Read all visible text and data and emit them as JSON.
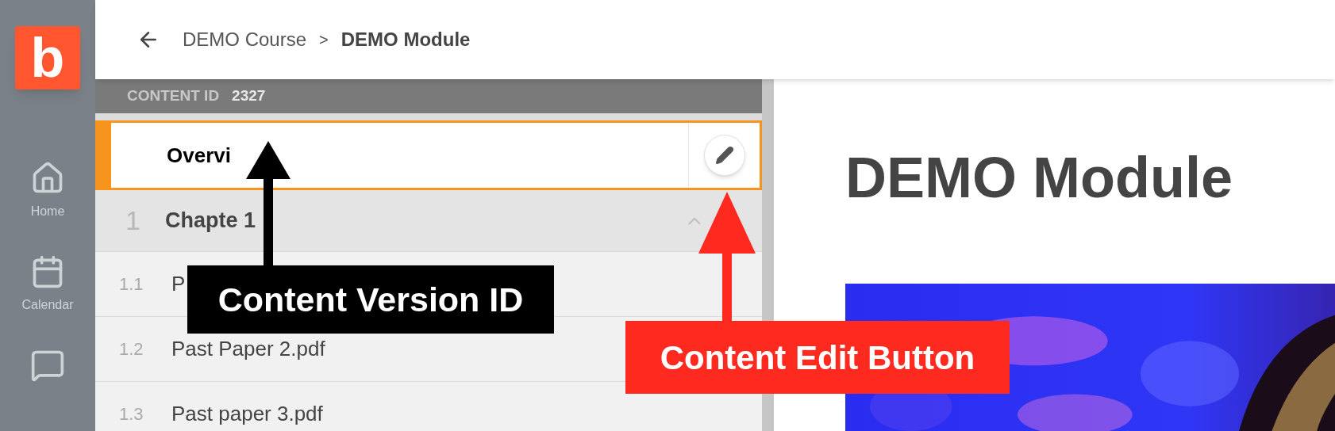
{
  "app_logo": {
    "letter": "b"
  },
  "nav": [
    {
      "label": "Home",
      "kind": "home"
    },
    {
      "label": "Calendar",
      "kind": "calendar"
    },
    {
      "kind": "chat"
    }
  ],
  "breadcrumb": {
    "separator": ">",
    "items": [
      {
        "label": "DEMO Course",
        "current": false
      },
      {
        "label": "DEMO Module",
        "current": true
      }
    ]
  },
  "content_id": {
    "label": "CONTENT ID",
    "value": "2327"
  },
  "outline": [
    {
      "kind": "overview",
      "title": "Overvi",
      "selected": true
    },
    {
      "kind": "chapter",
      "number": "1",
      "title": "Chapte 1",
      "expanded": true,
      "selected": false,
      "children": [
        {
          "number": "1.1",
          "title": "P",
          "selected": false
        },
        {
          "number": "1.2",
          "title": "Past Paper 2.pdf",
          "selected": false
        },
        {
          "number": "1.3",
          "title": "Past paper 3.pdf",
          "selected": false
        }
      ]
    }
  ],
  "page": {
    "title": "DEMO Module"
  },
  "annotations": [
    {
      "kind": "version-id",
      "text": "Content Version ID",
      "color": "#000000"
    },
    {
      "kind": "edit-button",
      "text": "Content Edit Button",
      "color": "#ff2a1f"
    }
  ]
}
